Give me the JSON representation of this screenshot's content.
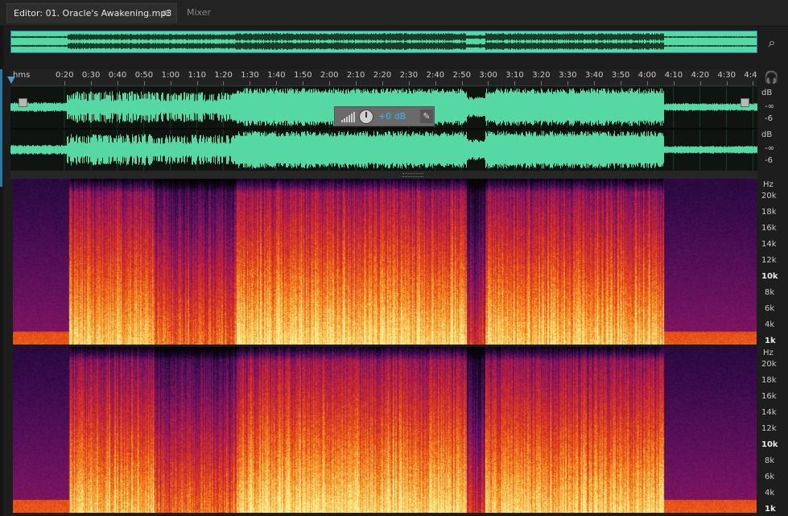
{
  "tabs": {
    "editor_label": "Editor: 01. Oracle's Awakening.mp3",
    "mixer_label": "Mixer",
    "menu_icon": "hamburger-menu-icon"
  },
  "ruler": {
    "unit_label": "hms",
    "ticks": [
      "0:20",
      "0:30",
      "0:40",
      "0:50",
      "1:00",
      "1:10",
      "1:20",
      "1:30",
      "1:40",
      "1:50",
      "2:00",
      "2:10",
      "2:20",
      "2:30",
      "2:40",
      "2:50",
      "3:00",
      "3:10",
      "3:20",
      "3:30",
      "3:40",
      "3:50",
      "4:00",
      "4:10",
      "4:20",
      "4:30",
      "4:4"
    ]
  },
  "hud": {
    "volume_value": "+0 dB"
  },
  "waveform_scale": {
    "unit": "dB",
    "labels": [
      "-∞",
      "-6"
    ]
  },
  "spectral_scale": {
    "unit": "Hz",
    "labels": [
      "20k",
      "18k",
      "16k",
      "14k",
      "12k",
      "10k",
      "8k",
      "6k",
      "4k",
      "1k"
    ],
    "bold_labels": [
      "10k",
      "1k"
    ]
  },
  "colors": {
    "waveform": "#55d8a4",
    "selection_border": "#2a7aa8",
    "accent_blue": "#3fb5f0"
  }
}
